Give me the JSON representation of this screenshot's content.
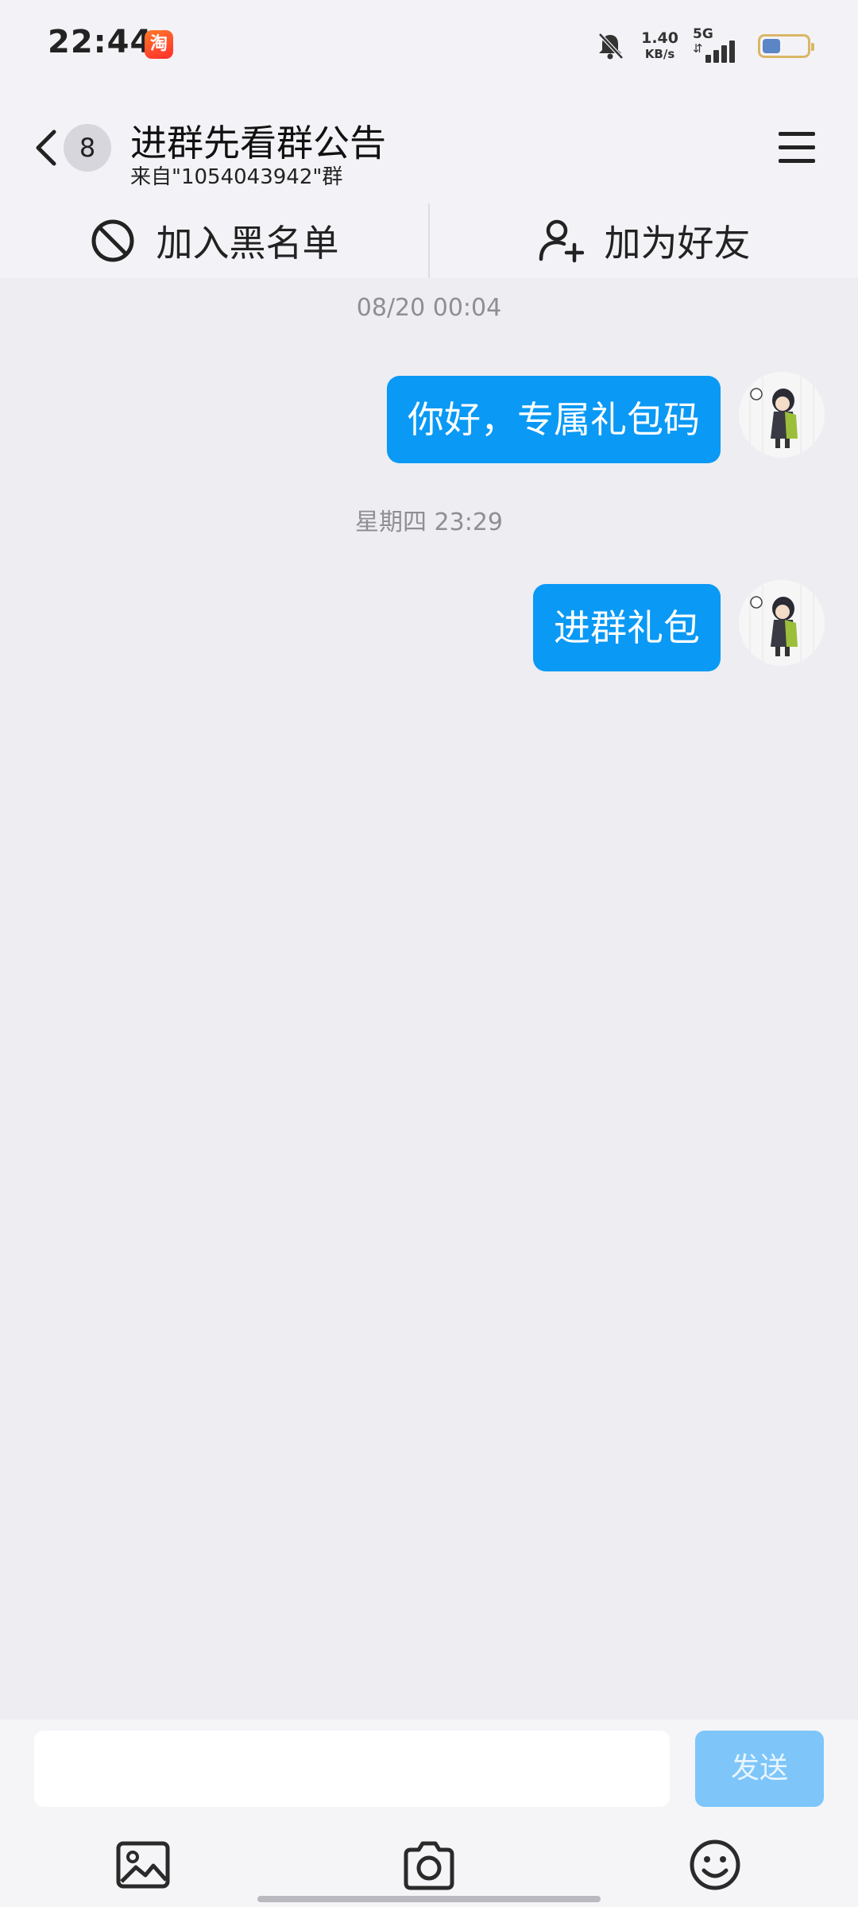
{
  "status_bar": {
    "time": "22:44",
    "app_badge": "淘",
    "net_speed_value": "1.40",
    "net_speed_unit": "KB/s",
    "network_type": "5G",
    "network_arrows": "⇵",
    "battery_level": 0.4,
    "battery_fill_color": "#5b86c5",
    "battery_border_color": "#d9b766"
  },
  "header": {
    "unread_count": "8",
    "title": "进群先看群公告",
    "subtitle": "来自\"1054043942\"群"
  },
  "actions": {
    "blacklist_label": "加入黑名单",
    "add_friend_label": "加为好友"
  },
  "chat": {
    "timestamp_1": "08/20 00:04",
    "message_1": "你好，专属礼包码",
    "timestamp_2": "星期四 23:29",
    "message_2": "进群礼包",
    "bubble_color": "#0a99f5"
  },
  "input_bar": {
    "input_value": "",
    "send_label": "发送",
    "send_color": "#7ec6fa"
  },
  "icons": {
    "back": "chevron-left-icon",
    "menu": "hamburger-menu-icon",
    "blacklist": "block-icon",
    "add_friend": "add-user-icon",
    "image": "image-icon",
    "camera": "camera-icon",
    "emoji": "emoji-icon"
  }
}
